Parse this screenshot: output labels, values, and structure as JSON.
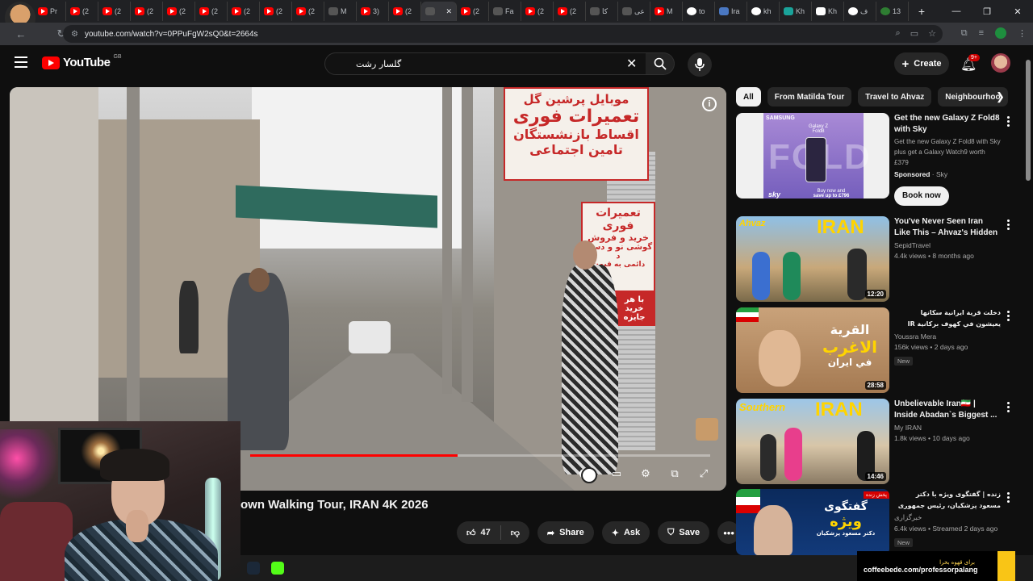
{
  "browser": {
    "tabs": [
      {
        "label": "Pr",
        "fav": "yt"
      },
      {
        "label": "(2",
        "fav": "yt"
      },
      {
        "label": "(2",
        "fav": "yt"
      },
      {
        "label": "(2",
        "fav": "yt"
      },
      {
        "label": "(2",
        "fav": "yt"
      },
      {
        "label": "(2",
        "fav": "yt"
      },
      {
        "label": "(2",
        "fav": "yt"
      },
      {
        "label": "(2",
        "fav": "yt"
      },
      {
        "label": "(2",
        "fav": "yt"
      },
      {
        "label": "M",
        "fav": "dark"
      },
      {
        "label": "3)",
        "fav": "yt"
      },
      {
        "label": "(2",
        "fav": "yt"
      },
      {
        "label": "",
        "fav": "active"
      },
      {
        "label": "(2",
        "fav": "yt"
      },
      {
        "label": "Fa",
        "fav": "dark"
      },
      {
        "label": "(2",
        "fav": "yt"
      },
      {
        "label": "(2",
        "fav": "yt"
      },
      {
        "label": "کا",
        "fav": "dark"
      },
      {
        "label": "عی",
        "fav": "dark"
      },
      {
        "label": "M",
        "fav": "yt"
      },
      {
        "label": "to",
        "fav": "g"
      },
      {
        "label": "Ira",
        "fav": "blue"
      },
      {
        "label": "kh",
        "fav": "g"
      },
      {
        "label": "Kh",
        "fav": "teal"
      },
      {
        "label": "Kh",
        "fav": "w"
      },
      {
        "label": "ف",
        "fav": "g"
      },
      {
        "label": "13",
        "fav": "green"
      }
    ],
    "url": "youtube.com/watch?v=0PPuFgW2sQ0&t=2664s"
  },
  "youtube": {
    "logo_text": "YouTube",
    "region": "GB",
    "search_value": "گلسار رشت",
    "create_label": "Create",
    "notifications": "9+"
  },
  "video": {
    "title": "own Walking Tour, IRAN 4K 2026",
    "progress": 0.45,
    "sign_top_1": "موبایل پرشین گل",
    "sign_top_2": "تعمیرات فوری",
    "sign_top_3": "اقساط بازنشستگان",
    "sign_top_4": "تامین اجتماعی",
    "sign_mid_1": "تعمیرات فوری",
    "sign_mid_2": "خرید و فروش",
    "sign_mid_3": "گوشی نو و دست د",
    "sign_mid_4": "دائمی به قیمت",
    "sign_low": "با هر خرید جایزه",
    "like_count": "47",
    "share_label": "Share",
    "ask_label": "Ask",
    "save_label": "Save"
  },
  "chips": [
    {
      "label": "All",
      "active": true
    },
    {
      "label": "From Matilda Tour",
      "active": false
    },
    {
      "label": "Travel to Ahvaz",
      "active": false
    },
    {
      "label": "Neighbourhoo",
      "active": false
    }
  ],
  "recs": [
    {
      "title": "Get the new Galaxy Z Fold8 with Sky",
      "desc": "Get the new Galaxy Z Fold8 with Sky plus get a Galaxy Watch9 worth £379",
      "sponsored": "Sponsored",
      "advertiser": "Sky",
      "button": "Book now",
      "thumb_brand": "SAMSUNG",
      "thumb_word": "FOLD",
      "thumb_model": "Galaxy Z Fold8",
      "thumb_offer_1": "Buy now and",
      "thumb_offer_2": "save up to £796",
      "thumb_logo": "sky"
    },
    {
      "title": "You've Never Seen Iran Like This – Ahvaz's Hidden ...",
      "channel": "SepidTravel",
      "meta": "4.4k views • 8 months ago",
      "duration": "12:20",
      "thumb_text_1": "Ahvaz",
      "thumb_text_2": "IRAN"
    },
    {
      "title": "دخلت قرية ايرانية سكانها يعيشون في كهوف بركانية IR",
      "channel": "Youssra Mera",
      "meta": "156k views • 2 days ago",
      "badge": "New",
      "duration": "28:58",
      "thumb_text_1": "القرية",
      "thumb_text_2": "الاغرب",
      "thumb_text_3": "في ايران"
    },
    {
      "title": "Unbelievable Iran🇮🇷 | Inside Abadan`s Biggest ...",
      "channel": "My IRAN",
      "meta": "1.8k views • 10 days ago",
      "duration": "14:46",
      "thumb_text_1": "Southern",
      "thumb_text_2": "IRAN"
    },
    {
      "title": "زنده | گفتگوی ویژه با دکتر مسعود پزشکیان، رئیس جمهوری اسلامی ایران",
      "channel": "خبرگزاری",
      "meta": "6.4k views • Streamed 2 days ago",
      "badge": "New",
      "thumb_tag": "پخش زنده",
      "thumb_text_1": "گفتگوی",
      "thumb_text_2": "ویژه",
      "thumb_text_3": "دکتر مسعود پزشکیان"
    }
  ],
  "overlay": {
    "banner_text": "برای قهوه بخرا",
    "banner_url": "coffeebede.com/professorpalang"
  },
  "colors": {
    "brand_red": "#ff0000",
    "background": "#0f0f0f"
  }
}
